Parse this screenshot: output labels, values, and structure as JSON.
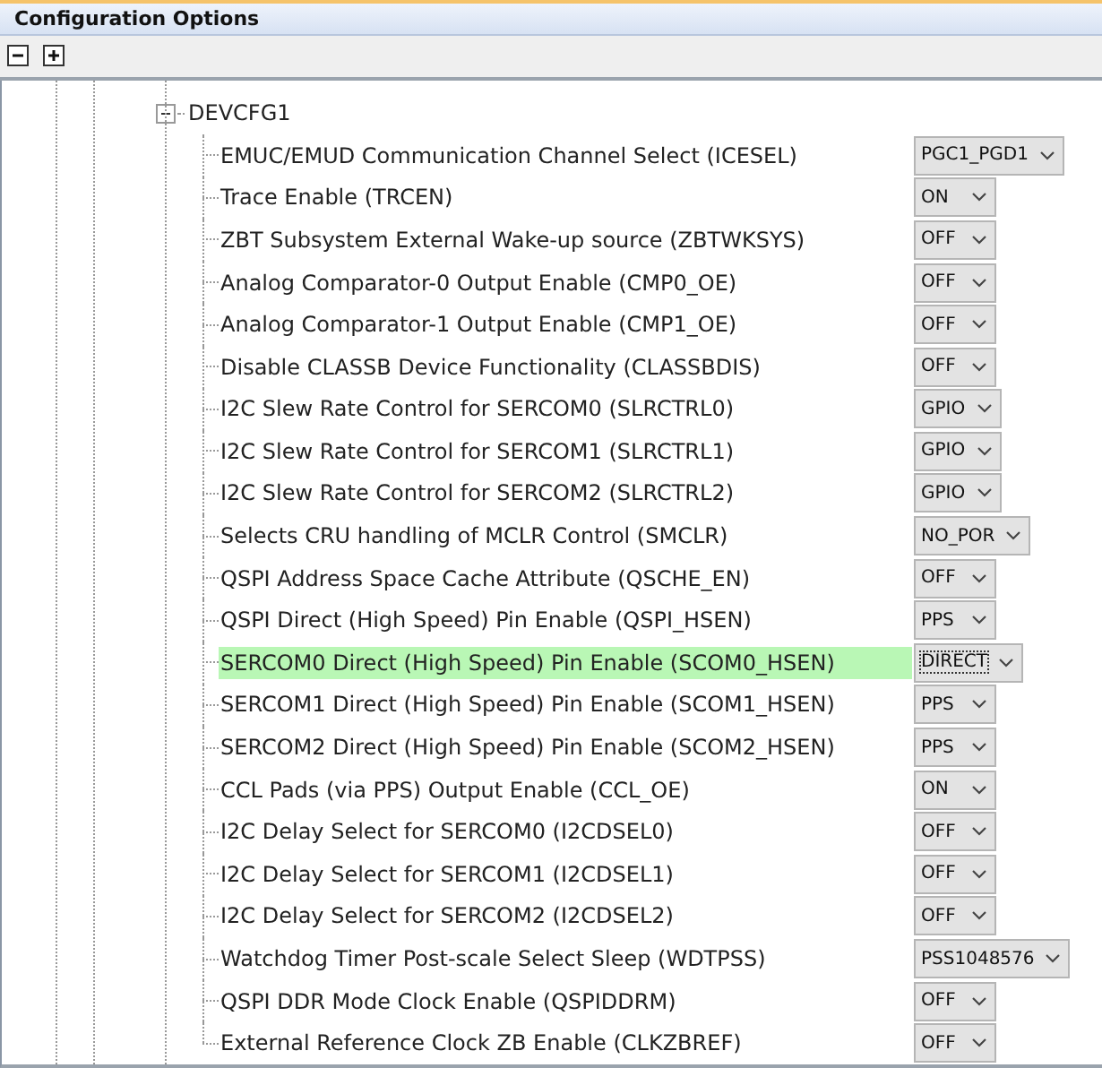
{
  "panel": {
    "title": "Configuration Options"
  },
  "toolbar": {
    "buttons": [
      {
        "kind": "collapse"
      },
      {
        "kind": "expand"
      }
    ]
  },
  "tree": {
    "label": "DEVCFG1",
    "expanded": true,
    "children": [
      {
        "label": "EMUC/EMUD Communication Channel Select (ICESEL)",
        "value": "PGC1_PGD1",
        "selected": false
      },
      {
        "label": "Trace Enable (TRCEN)",
        "value": "ON",
        "selected": false
      },
      {
        "label": "ZBT Subsystem External Wake-up source (ZBTWKSYS)",
        "value": "OFF",
        "selected": false
      },
      {
        "label": "Analog Comparator-0 Output Enable (CMP0_OE)",
        "value": "OFF",
        "selected": false
      },
      {
        "label": "Analog Comparator-1 Output Enable (CMP1_OE)",
        "value": "OFF",
        "selected": false
      },
      {
        "label": "Disable CLASSB Device Functionality (CLASSBDIS)",
        "value": "OFF",
        "selected": false
      },
      {
        "label": "I2C Slew Rate Control for SERCOM0 (SLRCTRL0)",
        "value": "GPIO",
        "selected": false
      },
      {
        "label": "I2C Slew Rate Control for SERCOM1 (SLRCTRL1)",
        "value": "GPIO",
        "selected": false
      },
      {
        "label": "I2C Slew Rate Control for SERCOM2 (SLRCTRL2)",
        "value": "GPIO",
        "selected": false
      },
      {
        "label": "Selects CRU handling of MCLR Control (SMCLR)",
        "value": "NO_POR",
        "selected": false
      },
      {
        "label": "QSPI Address Space Cache Attribute (QSCHE_EN)",
        "value": "OFF",
        "selected": false
      },
      {
        "label": "QSPI Direct (High Speed) Pin Enable (QSPI_HSEN)",
        "value": "PPS",
        "selected": false
      },
      {
        "label": "SERCOM0 Direct (High Speed) Pin Enable (SCOM0_HSEN)",
        "value": "DIRECT",
        "selected": true
      },
      {
        "label": "SERCOM1 Direct (High Speed) Pin Enable (SCOM1_HSEN)",
        "value": "PPS",
        "selected": false
      },
      {
        "label": "SERCOM2 Direct (High Speed) Pin Enable (SCOM2_HSEN)",
        "value": "PPS",
        "selected": false
      },
      {
        "label": "CCL Pads (via PPS) Output Enable (CCL_OE)",
        "value": "ON",
        "selected": false
      },
      {
        "label": "I2C Delay Select for SERCOM0 (I2CDSEL0)",
        "value": "OFF",
        "selected": false
      },
      {
        "label": "I2C Delay Select for SERCOM1 (I2CDSEL1)",
        "value": "OFF",
        "selected": false
      },
      {
        "label": "I2C Delay Select for SERCOM2 (I2CDSEL2)",
        "value": "OFF",
        "selected": false
      },
      {
        "label": "Watchdog Timer Post-scale Select Sleep (WDTPSS)",
        "value": "PSS1048576",
        "selected": false
      },
      {
        "label": "QSPI DDR Mode Clock Enable (QSPIDDRM)",
        "value": "OFF",
        "selected": false
      },
      {
        "label": "External Reference Clock ZB Enable (CLKZBREF)",
        "value": "OFF",
        "selected": false
      }
    ]
  }
}
